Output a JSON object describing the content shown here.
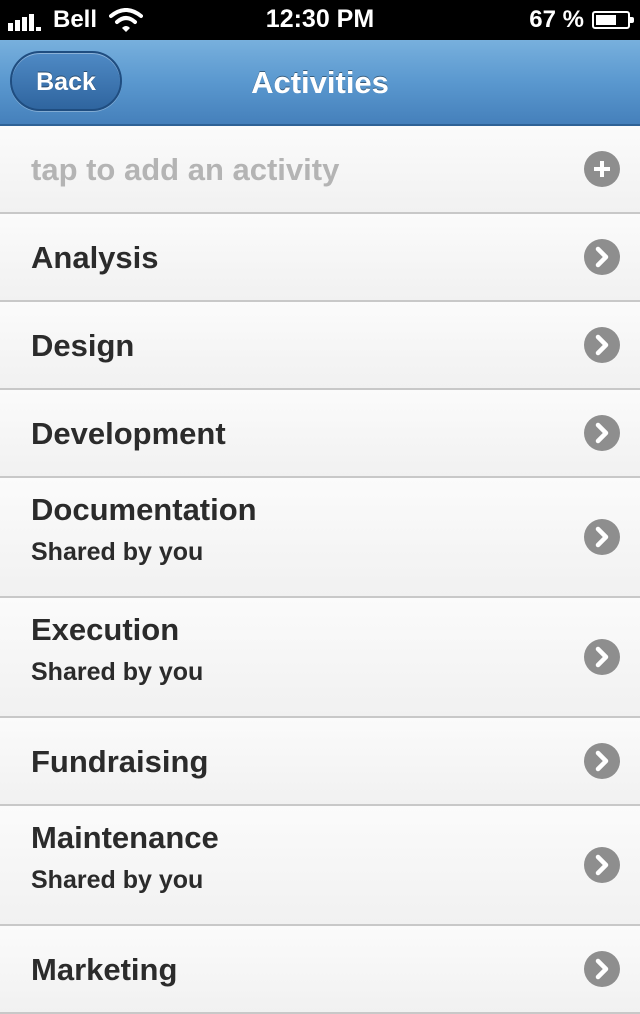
{
  "status_bar": {
    "carrier": "Bell",
    "time": "12:30 PM",
    "battery_text": "67 %",
    "battery_level": 0.67,
    "signal_icon": "signal-bars-icon",
    "wifi_icon": "wifi-icon"
  },
  "nav": {
    "back_label": "Back",
    "title": "Activities"
  },
  "add_row": {
    "placeholder": "tap to add an activity",
    "icon": "plus-circle-icon"
  },
  "activities": [
    {
      "name": "Analysis",
      "subtitle": ""
    },
    {
      "name": "Design",
      "subtitle": ""
    },
    {
      "name": "Development",
      "subtitle": ""
    },
    {
      "name": "Documentation",
      "subtitle": "Shared by you"
    },
    {
      "name": "Execution",
      "subtitle": "Shared by you"
    },
    {
      "name": "Fundraising",
      "subtitle": ""
    },
    {
      "name": "Maintenance",
      "subtitle": "Shared by you"
    },
    {
      "name": "Marketing",
      "subtitle": ""
    }
  ],
  "colors": {
    "nav_accent": "#5a98cf",
    "disclosure_icon": "#8e8e8e",
    "placeholder_text": "#b4b4b4"
  }
}
